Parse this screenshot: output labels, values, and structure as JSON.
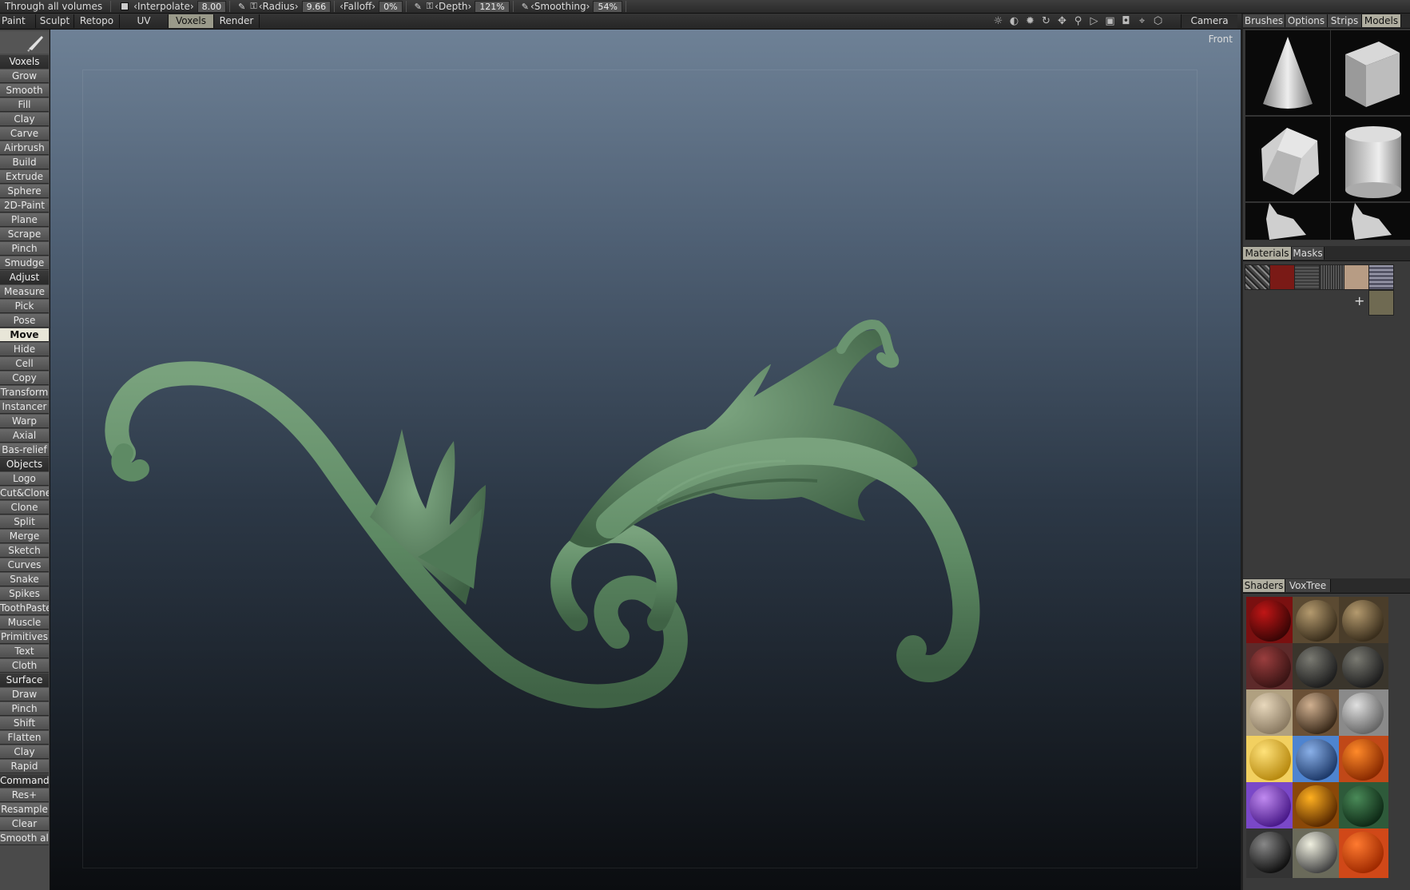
{
  "topbar": {
    "through_label": "Through  all  volumes",
    "interpolate_label": "‹Interpolate›",
    "interpolate_value": "8.00",
    "radius_label": "‹Radius›",
    "radius_value": "9.66",
    "falloff_label": "‹Falloff›",
    "falloff_value": "0%",
    "depth_label": "‹Depth›",
    "depth_value": "121%",
    "smoothing_label": "‹Smoothing›",
    "smoothing_value": "54%"
  },
  "menu": {
    "tabs": [
      "Paint",
      "Sculpt",
      "Retopo",
      "UV",
      "Voxels",
      "Render"
    ],
    "active": "Voxels",
    "camera": "Camera"
  },
  "viewport": {
    "view_label": "Front",
    "model_color": "#5e8a64"
  },
  "left_toolbar": {
    "items": [
      "Voxels",
      "Grow",
      "Smooth",
      "Fill",
      "Clay",
      "Carve",
      "Airbrush",
      "Build",
      "Extrude",
      "Sphere",
      "2D-Paint",
      "Plane",
      "Scrape",
      "Pinch",
      "Smudge",
      "Adjust",
      "Measure",
      "Pick",
      "Pose",
      "Move",
      "Hide",
      "Cell",
      "Copy",
      "Transform",
      "Instancer",
      "Warp",
      "Axial",
      "Bas-relief",
      "Objects",
      "Logo",
      "Cut&Clone",
      "Clone",
      "Split",
      "Merge",
      "Sketch",
      "Curves",
      "Snake",
      "Spikes",
      "ToothPaste",
      "Muscle",
      "Primitives",
      "Text",
      "Cloth",
      "Surface",
      "Draw",
      "Pinch",
      "Shift",
      "Flatten",
      "Clay",
      "Rapid",
      "Commands",
      "Res+",
      "Resample",
      "Clear",
      "Smooth  all"
    ],
    "sections": [
      "Voxels",
      "Adjust",
      "Objects",
      "Surface",
      "Commands"
    ],
    "active": "Move"
  },
  "right_panel": {
    "top_tabs": [
      "Brushes",
      "Options",
      "Strips",
      "Models"
    ],
    "top_active": "Models",
    "models": [
      "cone-model",
      "cube-model",
      "dodecahedron-model",
      "cylinder-model",
      "bust-model",
      "bust-model"
    ],
    "mid_tabs": [
      "Materials",
      "Masks"
    ],
    "mid_active": "Materials",
    "add_symbol": "+",
    "bottom_tabs": [
      "Shaders",
      "VoxTree"
    ],
    "bottom_active": "Shaders"
  },
  "colors": {
    "panel_bg": "#3a3a3a",
    "active_tab": "#b0aea0",
    "active_tool": "#e8e6d8"
  }
}
